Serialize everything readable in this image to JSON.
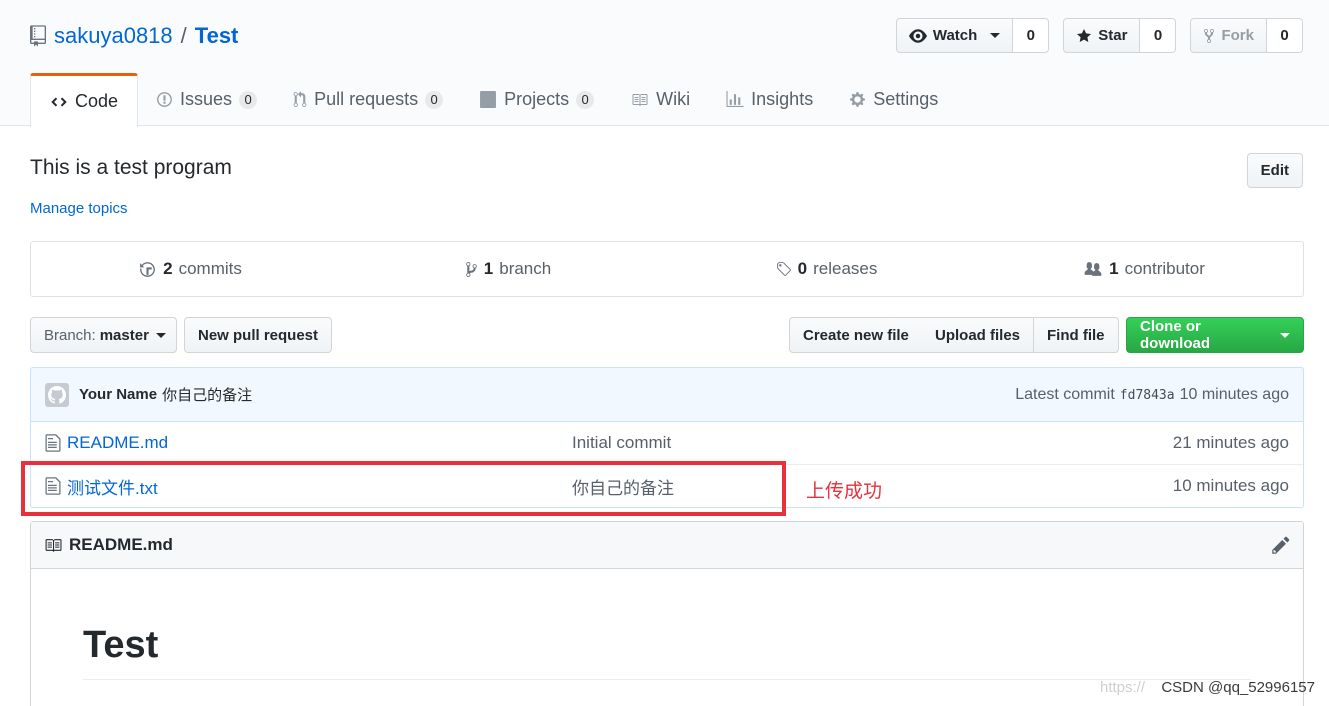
{
  "repo": {
    "owner": "sakuya0818",
    "separator": "/",
    "name": "Test"
  },
  "actions": {
    "watch": {
      "label": "Watch",
      "count": "0"
    },
    "star": {
      "label": "Star",
      "count": "0"
    },
    "fork": {
      "label": "Fork",
      "count": "0"
    }
  },
  "tabs": [
    {
      "label": "Code",
      "counter": ""
    },
    {
      "label": "Issues",
      "counter": "0"
    },
    {
      "label": "Pull requests",
      "counter": "0"
    },
    {
      "label": "Projects",
      "counter": "0"
    },
    {
      "label": "Wiki",
      "counter": ""
    },
    {
      "label": "Insights",
      "counter": ""
    },
    {
      "label": "Settings",
      "counter": ""
    }
  ],
  "description": "This is a test program",
  "manage_topics": "Manage topics",
  "edit_label": "Edit",
  "summary": {
    "commits": {
      "n": "2",
      "label": "commits"
    },
    "branch": {
      "n": "1",
      "label": "branch"
    },
    "releases": {
      "n": "0",
      "label": "releases"
    },
    "contributor": {
      "n": "1",
      "label": "contributor"
    }
  },
  "file_nav": {
    "branch_prefix": "Branch:",
    "branch_name": "master",
    "new_pull_request": "New pull request",
    "create_new_file": "Create new file",
    "upload_files": "Upload files",
    "find_file": "Find file",
    "clone_or_download": "Clone or download"
  },
  "latest_commit": {
    "author": "Your Name",
    "message": "你自己的备注",
    "prefix": "Latest commit",
    "sha": "fd7843a",
    "age": "10 minutes ago"
  },
  "files": [
    {
      "name": "README.md",
      "message": "Initial commit",
      "age": "21 minutes ago"
    },
    {
      "name": "测试文件.txt",
      "message": "你自己的备注",
      "age": "10 minutes ago"
    }
  ],
  "annotation": "上传成功",
  "readme": {
    "header": "README.md",
    "h1": "Test"
  },
  "watermark": {
    "faint": "https://",
    "main": "CSDN @qq_52996157"
  },
  "colors": {
    "accent": "#0366d6",
    "green": "#28a745",
    "tab_highlight": "#e36209",
    "annotation_red": "#e8313b"
  }
}
